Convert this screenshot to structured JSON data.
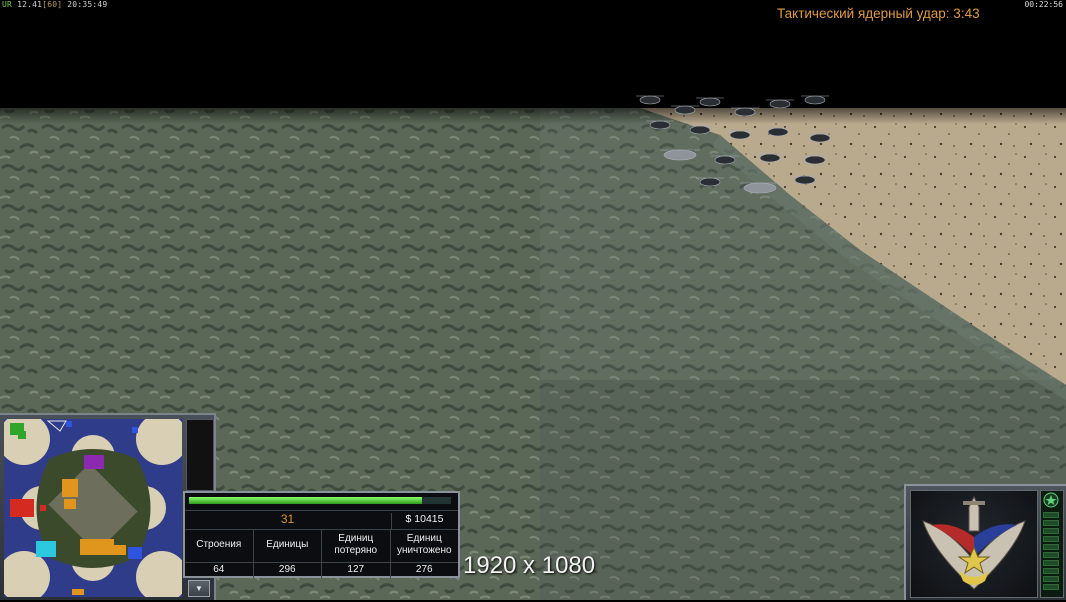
{
  "hud": {
    "tag": "UR",
    "fps_current": "12.41",
    "fps_cap": "[60]",
    "clock": "20:35:49",
    "game_time": "00:22:56"
  },
  "superweapon": {
    "timer_text": "Тактический ядерный удар: 3:43"
  },
  "overlay": {
    "resolution_text": "1920 x 1080"
  },
  "stats": {
    "health_fraction": 0.89,
    "count": "31",
    "money": "$ 10415",
    "columns": [
      {
        "label": "Строения",
        "value": "64"
      },
      {
        "label": "Единицы",
        "value": "296"
      },
      {
        "label": "Единиц потеряно",
        "value": "127"
      },
      {
        "label": "Единиц уничтожено",
        "value": "276"
      }
    ]
  },
  "minimap": {
    "toggle_icon": "chevron-down-icon"
  },
  "colors": {
    "terrain_grass": "#5d6a55",
    "sand": "#b8a88c",
    "timer_orange": "#e09a38",
    "health_green": "#5fd243",
    "player_red": "#d42a1f",
    "player_orange": "#e0951c",
    "player_cyan": "#2cc8e0",
    "player_blue": "#2f55e0",
    "player_purple": "#8b2ab0",
    "player_green": "#2fa52a"
  }
}
